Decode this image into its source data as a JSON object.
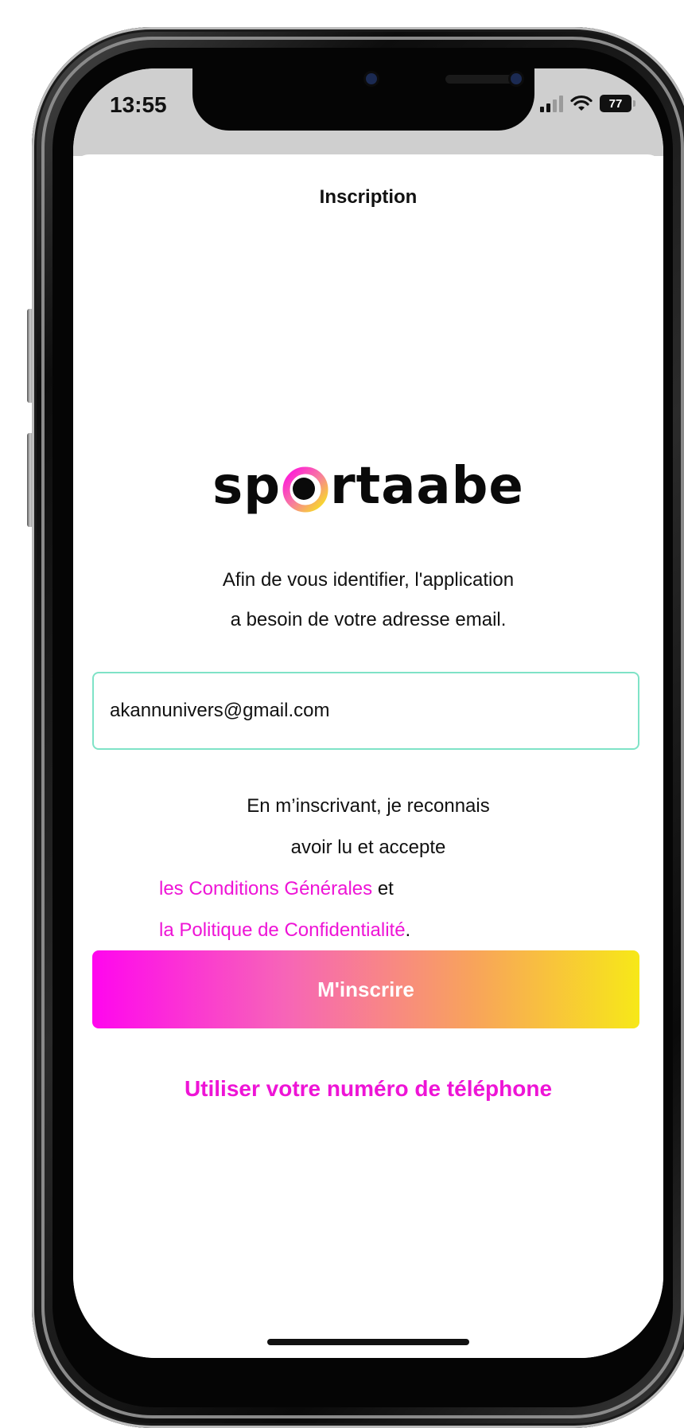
{
  "status_bar": {
    "time": "13:55",
    "battery": "77",
    "icons": [
      "cellular-signal-icon",
      "wifi-icon",
      "battery-icon"
    ]
  },
  "header": {
    "title": "Inscription"
  },
  "logo": {
    "wordmark_left": "sp",
    "wordmark_right": "rtaabe",
    "alt": "sportaabe"
  },
  "intro": {
    "line1": "Afin de vous identifier, l'application",
    "line2": "a besoin de votre adresse email."
  },
  "email": {
    "value": "akannunivers@gmail.com"
  },
  "legal": {
    "line1": "En m’inscrivant, je reconnais",
    "line2": "avoir lu et accepte",
    "terms_link": "les Conditions Générales",
    "and": "et",
    "privacy_link": "la Politique de Confidentialité",
    "period": "."
  },
  "actions": {
    "signup_label": "M'inscrire",
    "phone_link": "Utiliser votre numéro de téléphone"
  },
  "colors": {
    "accent": "#ee14d6",
    "gradient_start": "#ff06ee",
    "gradient_end": "#f7e818",
    "input_border": "#7fe3c7"
  }
}
